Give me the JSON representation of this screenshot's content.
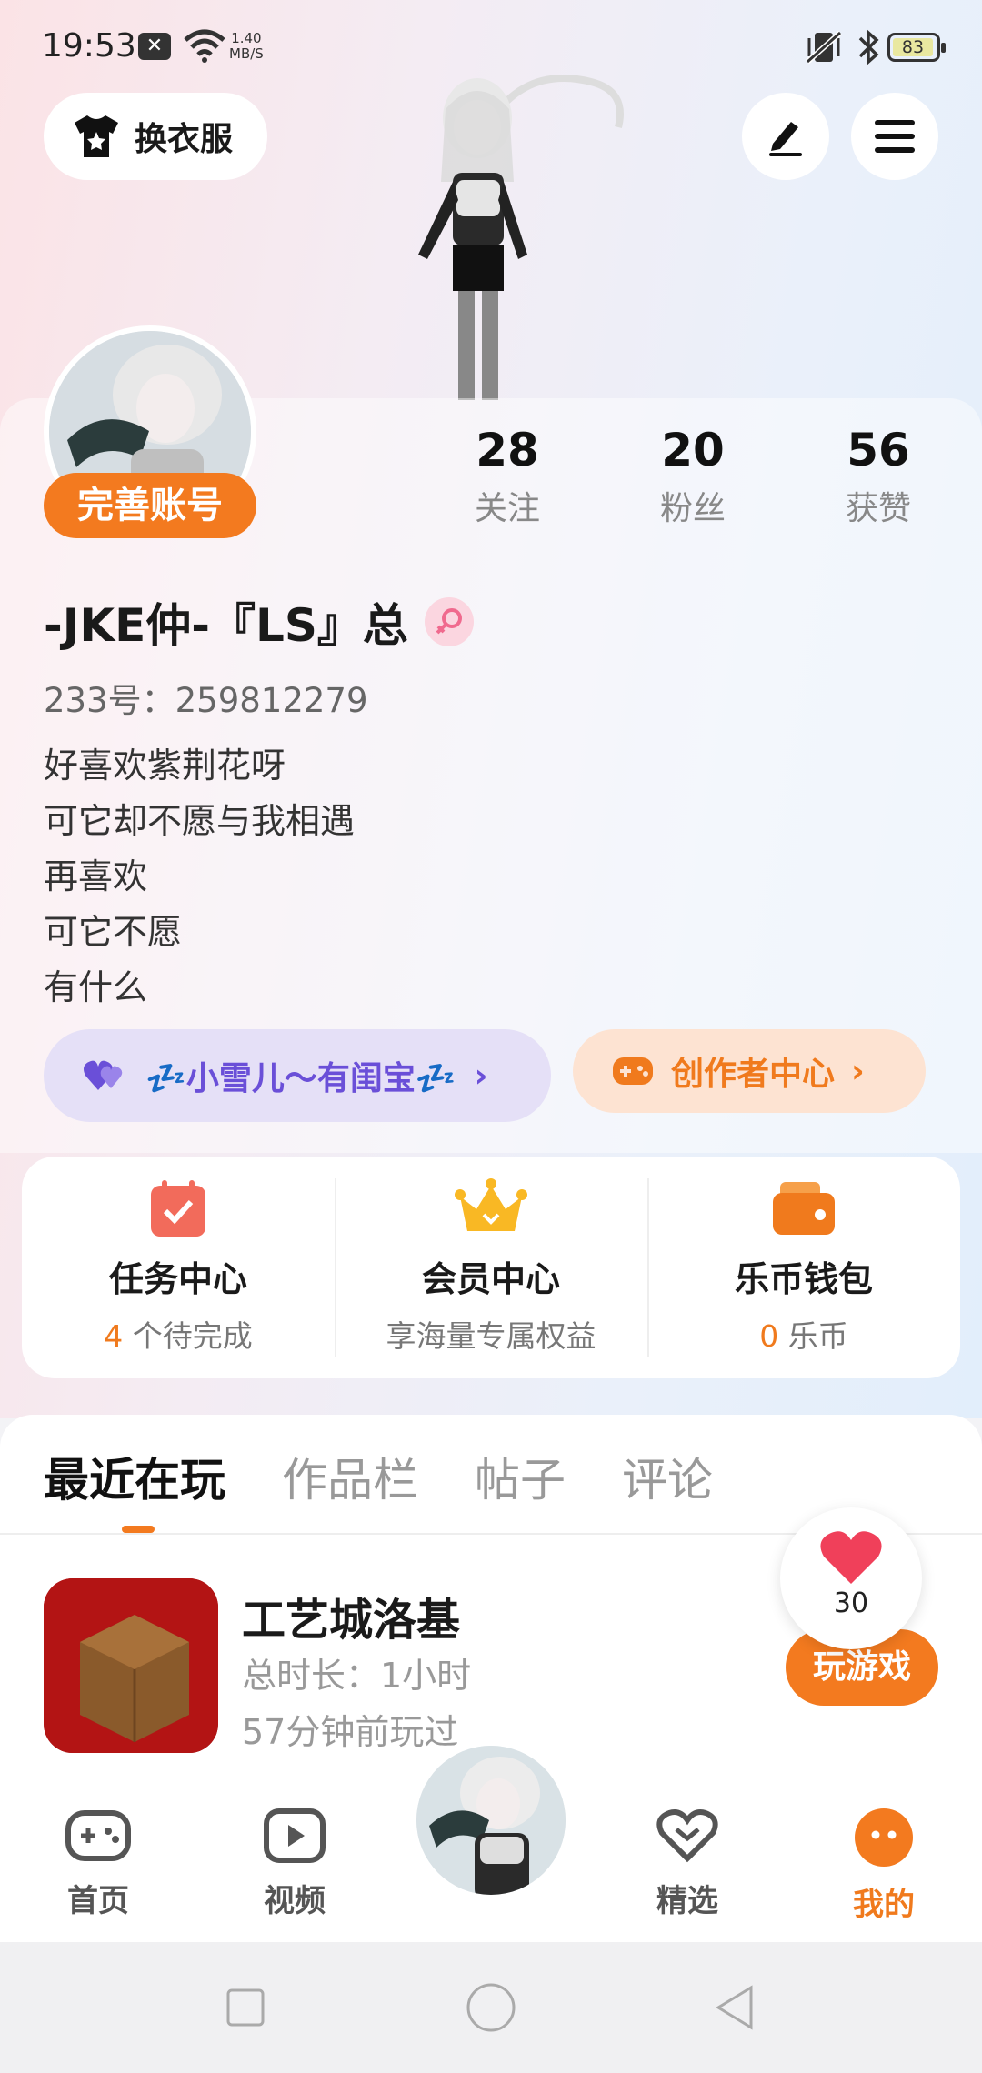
{
  "status": {
    "time": "19:53",
    "net_speed_value": "1.40",
    "net_speed_unit": "MB/S",
    "battery": "83"
  },
  "header": {
    "outfit_label": "换衣服"
  },
  "profile": {
    "complete_label": "完善账号",
    "stats": [
      {
        "value": "28",
        "label": "关注"
      },
      {
        "value": "20",
        "label": "粉丝"
      },
      {
        "value": "56",
        "label": "获赞"
      }
    ],
    "name": "-JKE仲-『LS』总",
    "id_text": "233号：259812279",
    "bio": [
      "好喜欢紫荆花呀",
      "可它却不愿与我相遇",
      "再喜欢",
      "可它不愿",
      "有什么"
    ],
    "fan_group_label": "💤小雪儿〜有闺宝💤",
    "creator_label": "创作者中心"
  },
  "quick": [
    {
      "title": "任务中心",
      "count": "4",
      "sub": "个待完成"
    },
    {
      "title": "会员中心",
      "count": "",
      "sub": "享海量专属权益"
    },
    {
      "title": "乐币钱包",
      "count": "0",
      "sub": "乐币"
    }
  ],
  "tabs": [
    "最近在玩",
    "作品栏",
    "帖子",
    "评论"
  ],
  "recent_game": {
    "title": "工艺城洛基",
    "duration": "总时长：1小时",
    "last_played": "57分钟前玩过",
    "play_label": "玩游戏"
  },
  "like_count": "30",
  "nav": [
    {
      "label": "首页",
      "icon": "gamepad-icon"
    },
    {
      "label": "视频",
      "icon": "video-icon"
    },
    {
      "label": "精选",
      "icon": "heart-chat-icon"
    },
    {
      "label": "我的",
      "icon": "me-icon"
    }
  ],
  "colors": {
    "accent": "#f37a1f",
    "purple": "#6a4fd8"
  }
}
